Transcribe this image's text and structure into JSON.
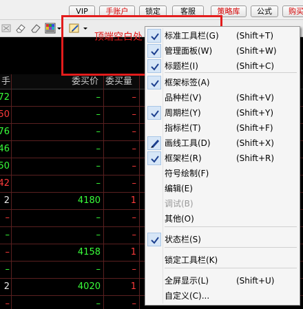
{
  "topbar": {
    "buttons": [
      "VIP",
      "手账户",
      "锁定",
      "客服",
      "策略库",
      "公式",
      "购买"
    ]
  },
  "table": {
    "headers": [
      "手",
      "委买价",
      "委买量"
    ],
    "rows": [
      {
        "a": "72",
        "price": "–",
        "vol": "–"
      },
      {
        "a": "50",
        "price": "–",
        "vol": "–"
      },
      {
        "a": "76",
        "price": "–",
        "vol": "–"
      },
      {
        "a": "46",
        "price": "–",
        "vol": "–"
      },
      {
        "a": "50",
        "price": "–",
        "vol": "–"
      },
      {
        "a": "42",
        "price": "–",
        "vol": "–"
      },
      {
        "a": "2",
        "price": "4180",
        "vol": "1"
      },
      {
        "a": "–",
        "price": "–",
        "vol": "–"
      },
      {
        "a": "–",
        "price": "–",
        "vol": "–"
      },
      {
        "a": "–",
        "price": "4158",
        "vol": "1"
      },
      {
        "a": "–",
        "price": "–",
        "vol": "–"
      },
      {
        "a": "2",
        "price": "4020",
        "vol": "1"
      },
      {
        "a": "–",
        "price": "–",
        "vol": "–"
      }
    ]
  },
  "menu": {
    "items": [
      {
        "label": "标准工具栏(G)",
        "shortcut": "(Shift+T)",
        "checked": true
      },
      {
        "label": "管理面板(W)",
        "shortcut": "(Shift+W)",
        "checked": true
      },
      {
        "label": "标题栏(I)",
        "shortcut": "(Shift+C)",
        "checked": true
      },
      {
        "label": "框架标签(A)",
        "shortcut": "",
        "checked": true
      },
      {
        "label": "品种栏(V)",
        "shortcut": "(Shift+V)",
        "checked": false
      },
      {
        "label": "周期栏(Y)",
        "shortcut": "(Shift+Y)",
        "checked": true
      },
      {
        "label": "指标栏(T)",
        "shortcut": "(Shift+F)",
        "checked": false
      },
      {
        "label": "画线工具(D)",
        "shortcut": "(Shift+X)",
        "checked": false,
        "pencil": true
      },
      {
        "label": "框架栏(R)",
        "shortcut": "(Shift+R)",
        "checked": true
      },
      {
        "label": "符号绘制(F)",
        "shortcut": "",
        "checked": false
      },
      {
        "label": "编辑(E)",
        "shortcut": "",
        "checked": false
      },
      {
        "label": "调试(B)",
        "shortcut": "",
        "checked": false,
        "disabled": true
      },
      {
        "label": "其他(O)",
        "shortcut": "",
        "checked": false
      },
      {
        "label": "状态栏(S)",
        "shortcut": "",
        "checked": true
      },
      {
        "label": "锁定工具栏(K)",
        "shortcut": "",
        "checked": false
      },
      {
        "label": "全屏显示(L)",
        "shortcut": "(Shift+U)",
        "checked": false
      },
      {
        "label": "自定义(C)...",
        "shortcut": "",
        "checked": false
      }
    ]
  },
  "annotation": {
    "text": "顶端空白处 右键菜单"
  },
  "colors": {
    "up": "#39ff3a",
    "down": "#ff3b3b",
    "annotation": "#e31c1c"
  },
  "icons": [
    "eraser-icon",
    "grid-color-icon",
    "pencil-icon",
    "scissors-icon"
  ]
}
